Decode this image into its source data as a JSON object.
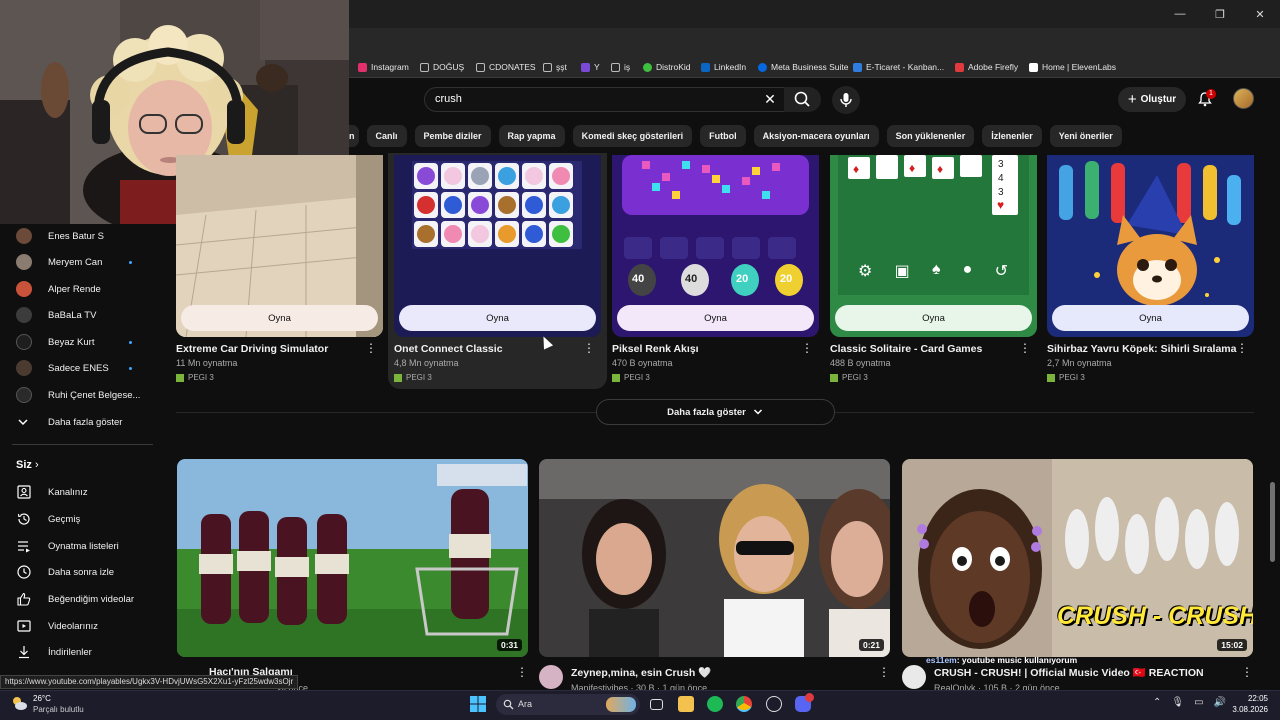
{
  "browser": {
    "bookmarks": [
      {
        "label": "Instagram",
        "color": "#e1306c"
      },
      {
        "label": "DOĞUŞ",
        "color": "#888888"
      },
      {
        "label": "CDONATES",
        "color": "#888888"
      },
      {
        "label": "şşt",
        "color": "#888888"
      },
      {
        "label": "Y",
        "color": "#7a4ad6"
      },
      {
        "label": "iş",
        "color": "#888888"
      },
      {
        "label": "DistroKid",
        "color": "#3fbf3f"
      },
      {
        "label": "LinkedIn",
        "color": "#0a66c2"
      },
      {
        "label": "Meta Business Suite",
        "color": "#0668e1"
      },
      {
        "label": "E-Ticaret - Kanban...",
        "color": "#2f7de1"
      },
      {
        "label": "Adobe Firefly",
        "color": "#e03a3e"
      },
      {
        "label": "Home | ElevenLabs",
        "color": "#ffffff"
      }
    ]
  },
  "header": {
    "search_query": "crush",
    "create_label": "Oluştur",
    "notification_count": "1"
  },
  "chips": [
    "n",
    "Canlı",
    "Pembe diziler",
    "Rap yapma",
    "Komedi skeç gösterileri",
    "Futbol",
    "Aksiyon-macera oyunları",
    "Son yüklenenler",
    "İzlenenler",
    "Yeni öneriler"
  ],
  "sidebar": {
    "subscriptions": [
      {
        "name": "Enes Batur S",
        "live": false,
        "color": "#6b4a3a"
      },
      {
        "name": "Meryem Can",
        "live": true,
        "color": "#8a7c70"
      },
      {
        "name": "Alper Rende",
        "live": false,
        "color": "#c9523a"
      },
      {
        "name": "BaBaLa TV",
        "live": false,
        "color": "#3c3c3c"
      },
      {
        "name": "Beyaz Kurt",
        "live": true,
        "color": "#1e1e1e"
      },
      {
        "name": "Sadece ENES",
        "live": true,
        "color": "#4a3a30"
      },
      {
        "name": "Ruhi Çenet Belgese...",
        "live": false,
        "color": "#2a2a2a"
      }
    ],
    "show_more": "Daha fazla göster",
    "you_section": "Siz",
    "you_items": [
      {
        "label": "Kanalınız",
        "icon": "channel-icon"
      },
      {
        "label": "Geçmiş",
        "icon": "history-icon"
      },
      {
        "label": "Oynatma listeleri",
        "icon": "playlists-icon"
      },
      {
        "label": "Daha sonra izle",
        "icon": "watch-later-icon"
      },
      {
        "label": "Beğendiğim videolar",
        "icon": "like-icon"
      },
      {
        "label": "Videolarınız",
        "icon": "your-videos-icon"
      },
      {
        "label": "İndirilenler",
        "icon": "download-icon"
      }
    ]
  },
  "games": [
    {
      "title": "Extreme Car Driving Simulator",
      "plays": "11 Mn oynatma",
      "rating": "PEGI 3",
      "play_label": "Oyna",
      "button_color": "#f7ebe6"
    },
    {
      "title": "Onet Connect Classic",
      "plays": "4,8 Mn oynatma",
      "rating": "PEGI 3",
      "play_label": "Oyna",
      "button_color": "#e9e9fb"
    },
    {
      "title": "Piksel Renk Akışı",
      "plays": "470 B oynatma",
      "rating": "PEGI 3",
      "play_label": "Oyna",
      "button_color": "#f2e8fa"
    },
    {
      "title": "Classic Solitaire - Card Games",
      "plays": "488 B oynatma",
      "rating": "PEGI 3",
      "play_label": "Oyna",
      "button_color": "#e8f6ea"
    },
    {
      "title": "Sihirbaz Yavru Köpek: Sihirli Sıralama",
      "plays": "2,7 Mn oynatma",
      "rating": "PEGI 3",
      "play_label": "Oyna",
      "button_color": "#e6e9fb"
    }
  ],
  "shelf_more": "Daha fazla göster",
  "videos": [
    {
      "title": "Hacı'nın Salgamı",
      "meta": "yıl önce",
      "duration": "0:31"
    },
    {
      "title": "Zeynep,mina, esin Crush 🤍",
      "meta": "Manifestivibes · 30 B · 1 gün önce",
      "duration": "0:21"
    },
    {
      "title": "CRUSH - CRUSH! | Official Music Video 🇹🇷 REACTION",
      "meta": "RealOnlyk · 105 B · 2 gün önce",
      "duration": "15:02",
      "thumb_text": "CRUSH - CRUSH!"
    }
  ],
  "status_url": "https://www.youtube.com/playables/Ugkx3V-HDvjUWsG5X2Xu1-yFzl25wdw3sOjr",
  "chat_overlay": {
    "user": "es11em",
    "message": ": youtube music kullanıyorum"
  },
  "taskbar": {
    "temperature": "26°C",
    "weather": "Parçalı bulutlu",
    "search_placeholder": "Ara",
    "time": "22:05",
    "date": "3.08.2026"
  }
}
